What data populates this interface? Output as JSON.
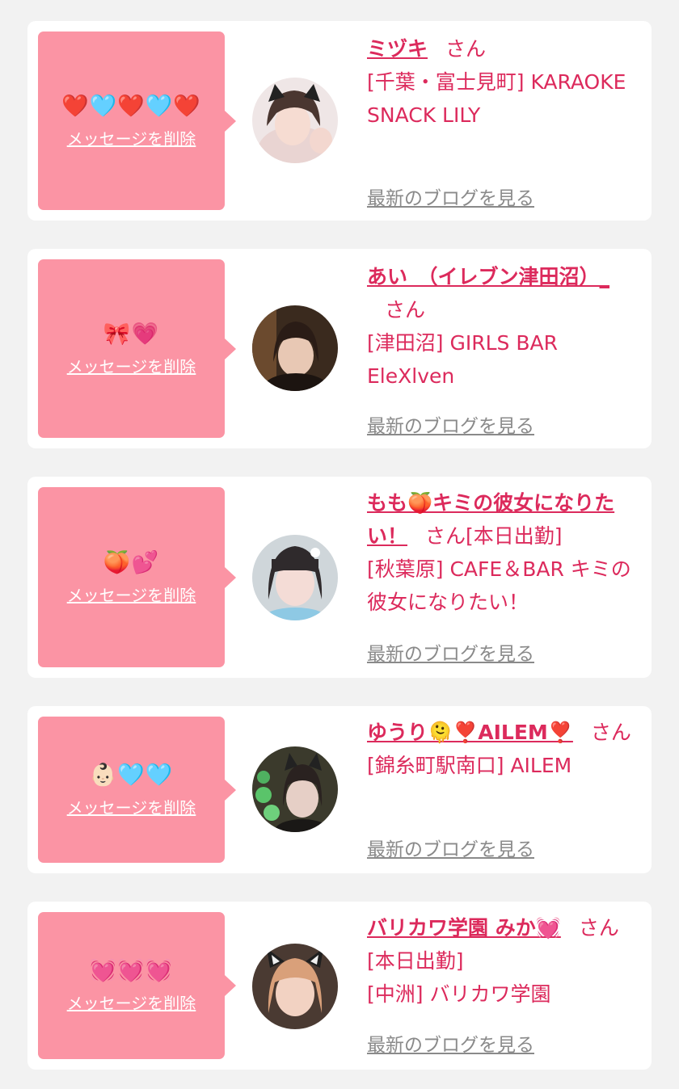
{
  "cards": [
    {
      "emoji": "❤️🩵❤️🩵❤️",
      "delete_label": "メッセージを削除",
      "name": "ミヅキ",
      "honorific": "さん",
      "status": "",
      "shop": "[千葉・富士見町] KARAOKE SNACK LILY",
      "blog_label": "最新のブログを見る"
    },
    {
      "emoji": "🎀💗",
      "delete_label": "メッセージを削除",
      "name": "あい　（イレブン津田沼）_",
      "honorific": "さん",
      "status": "",
      "shop": "[津田沼] GIRLS BAR EleXlven",
      "blog_label": "最新のブログを見る"
    },
    {
      "emoji": "🍑💕",
      "delete_label": "メッセージを削除",
      "name": "もも🍑キミの彼女になりたい！",
      "honorific": "さん",
      "status": "[本日出勤]",
      "shop": "[秋葉原] CAFE＆BAR キミの彼女になりたい！",
      "blog_label": "最新のブログを見る"
    },
    {
      "emoji": "👶🏻🩵🩵",
      "delete_label": "メッセージを削除",
      "name": "ゆうり🫠❣️AILEM❣️",
      "honorific": "さん",
      "status": "",
      "shop": "[錦糸町駅南口] AILEM",
      "blog_label": "最新のブログを見る"
    },
    {
      "emoji": "💓💓💓",
      "delete_label": "メッセージを削除",
      "name": "バリカワ学園 みか💓",
      "honorific": "さん",
      "status": "[本日出勤]",
      "shop": "[中洲] バリカワ学園",
      "blog_label": "最新のブログを見る"
    }
  ],
  "colors": {
    "background": "#f2f2f2",
    "card": "#ffffff",
    "bubble": "#fb94a4",
    "accent_text": "#dc2a5c",
    "link_gray": "#8a8a8a"
  }
}
